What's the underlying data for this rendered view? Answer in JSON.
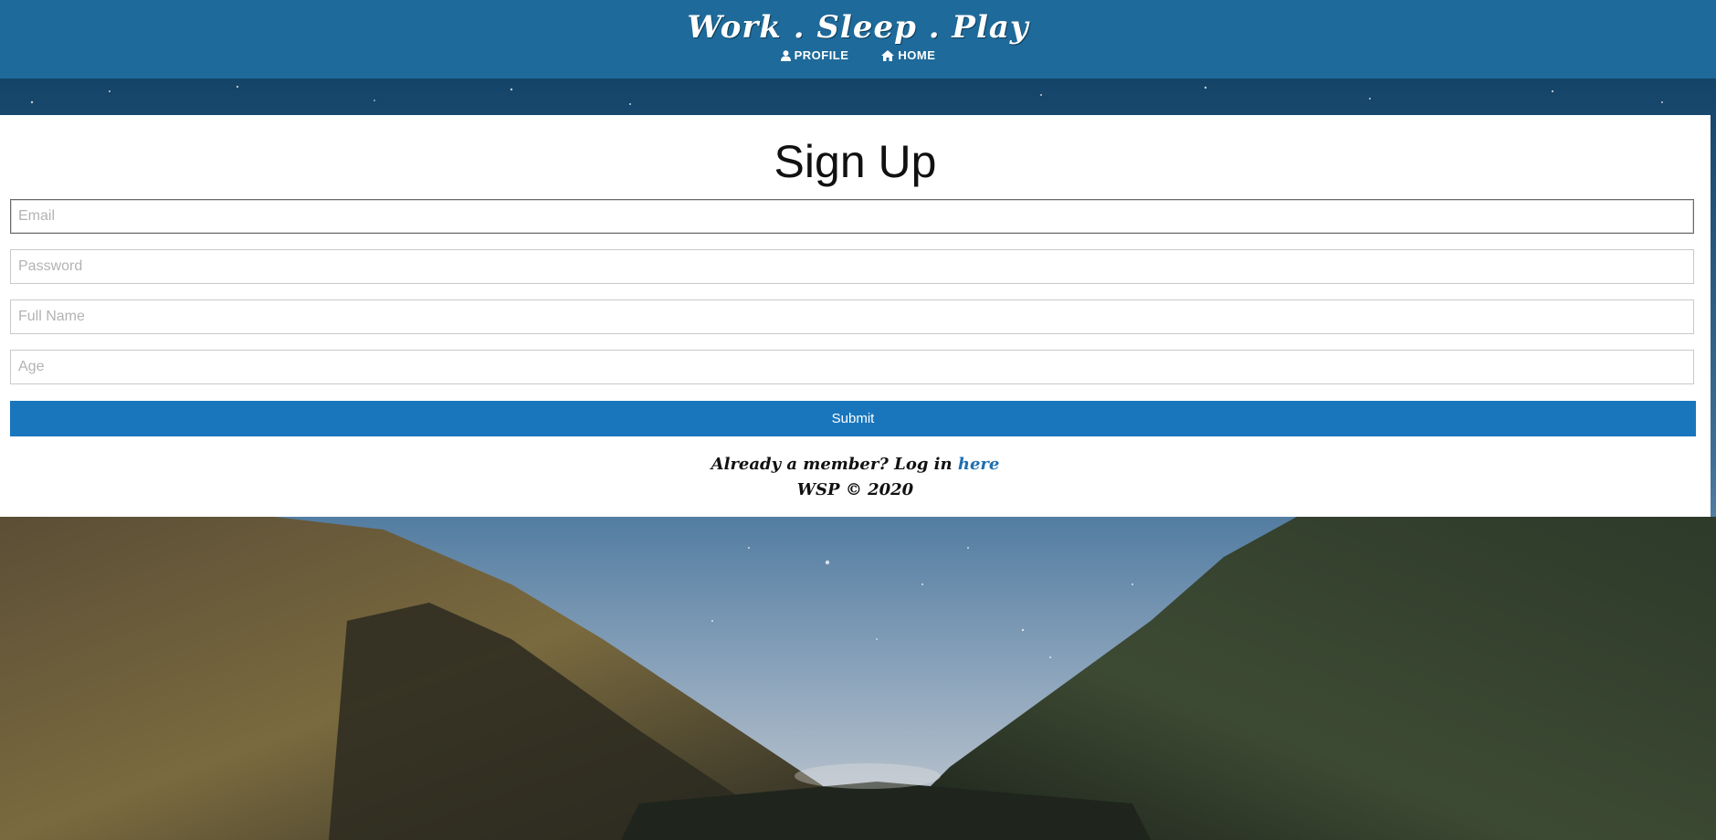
{
  "header": {
    "brand": "Work . Sleep . Play",
    "nav": [
      {
        "label": "PROFILE",
        "icon": "user-icon"
      },
      {
        "label": "HOME",
        "icon": "home-icon"
      }
    ]
  },
  "form": {
    "title": "Sign Up",
    "fields": [
      {
        "placeholder": "Email",
        "value": ""
      },
      {
        "placeholder": "Password",
        "value": ""
      },
      {
        "placeholder": "Full Name",
        "value": ""
      },
      {
        "placeholder": "Age",
        "value": ""
      }
    ],
    "submit_label": "Submit",
    "member_prompt": "Already a member? Log in ",
    "login_link": "here",
    "copyright": "WSP © 2020"
  },
  "colors": {
    "header_bg": "#1e6a9a",
    "button_bg": "#1976bd",
    "link": "#1f6fb0"
  }
}
